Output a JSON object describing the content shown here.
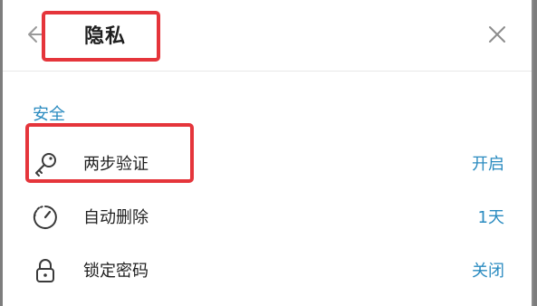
{
  "dialog": {
    "title": "隐私",
    "back_icon": "arrow-left-icon",
    "close_icon": "close-icon"
  },
  "section": {
    "label": "安全"
  },
  "rows": [
    {
      "icon": "key-icon",
      "label": "两步验证",
      "value": "开启"
    },
    {
      "icon": "timer-icon",
      "label": "自动删除",
      "value": "1天"
    },
    {
      "icon": "lock-icon",
      "label": "锁定密码",
      "value": "关闭"
    }
  ],
  "colors": {
    "accent": "#2a8bc0",
    "highlight": "#e5353b",
    "text": "#1f1f1f"
  }
}
